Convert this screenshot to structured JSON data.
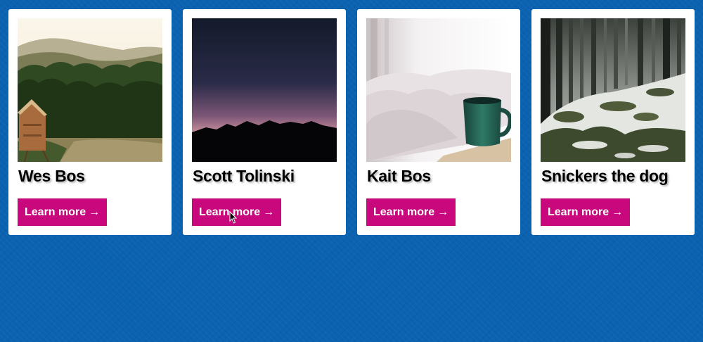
{
  "cards": [
    {
      "title": "Wes Bos",
      "button_label": "Learn more",
      "button_icon": "arrow-right-icon",
      "image": "mountain-cabin-forest-photo"
    },
    {
      "title": "Scott Tolinski",
      "button_label": "Learn more",
      "button_icon": "arrow-right-icon",
      "image": "sunset-mountain-silhouette-photo"
    },
    {
      "title": "Kait Bos",
      "button_label": "Learn more",
      "button_icon": "arrow-right-icon",
      "image": "coffee-mug-bed-photo"
    },
    {
      "title": "Snickers the dog",
      "button_label": "Learn more",
      "button_icon": "arrow-right-icon",
      "image": "snowy-forest-photo"
    }
  ],
  "colors": {
    "background": "#0a62b0",
    "card": "#ffffff",
    "button": "#c8087c",
    "button_text": "#ffffff"
  }
}
